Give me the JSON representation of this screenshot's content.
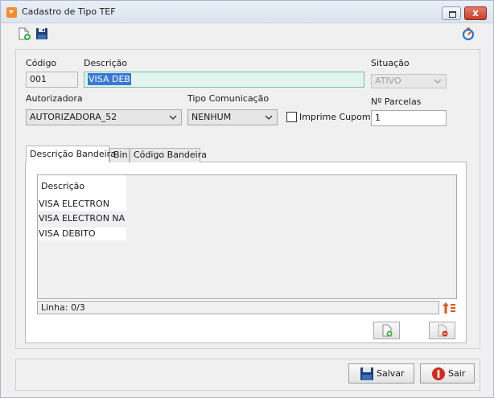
{
  "window": {
    "title": "Cadastro de Tipo TEF",
    "icons": {
      "app": "dropdown-app-icon",
      "minimize": "restore-icon",
      "close": "close-icon",
      "close_glyph": "x"
    }
  },
  "toolbar": {
    "icons": [
      "new-document-icon",
      "save-disk-icon",
      "refresh-timer-icon"
    ]
  },
  "form": {
    "codigo": {
      "label": "Código",
      "value": "001"
    },
    "descricao": {
      "label": "Descrição",
      "value": "VISA DEB"
    },
    "situacao": {
      "label": "Situação",
      "value": "ATIVO"
    },
    "autorizadora": {
      "label": "Autorizadora",
      "value": "AUTORIZADORA_52"
    },
    "tipo_comunicacao": {
      "label": "Tipo Comunicação",
      "value": "NENHUM"
    },
    "imprime_cupom": {
      "label": "Imprime Cupom",
      "checked": false
    },
    "parcelas": {
      "label": "Nº Parcelas",
      "value": "1"
    }
  },
  "tabs": [
    {
      "label": "Descrição Bandeira",
      "active": true
    },
    {
      "label": "Bin",
      "active": false
    },
    {
      "label": "Código Bandeira",
      "active": false
    }
  ],
  "grid": {
    "column_header": "Descrição",
    "rows": [
      "VISA ELECTRON",
      "VISA ELECTRON NA",
      "VISA DEBITO"
    ]
  },
  "status": {
    "text": "Linha: 0/3"
  },
  "footer": {
    "salvar": "Salvar",
    "sair": "Sair"
  },
  "colors": {
    "accent_orange": "#f58c2a",
    "selection_blue": "#3a78d6",
    "focus_field": "#e2f5ec",
    "exit_red": "#d22b1e",
    "add_green": "#3cb043"
  }
}
